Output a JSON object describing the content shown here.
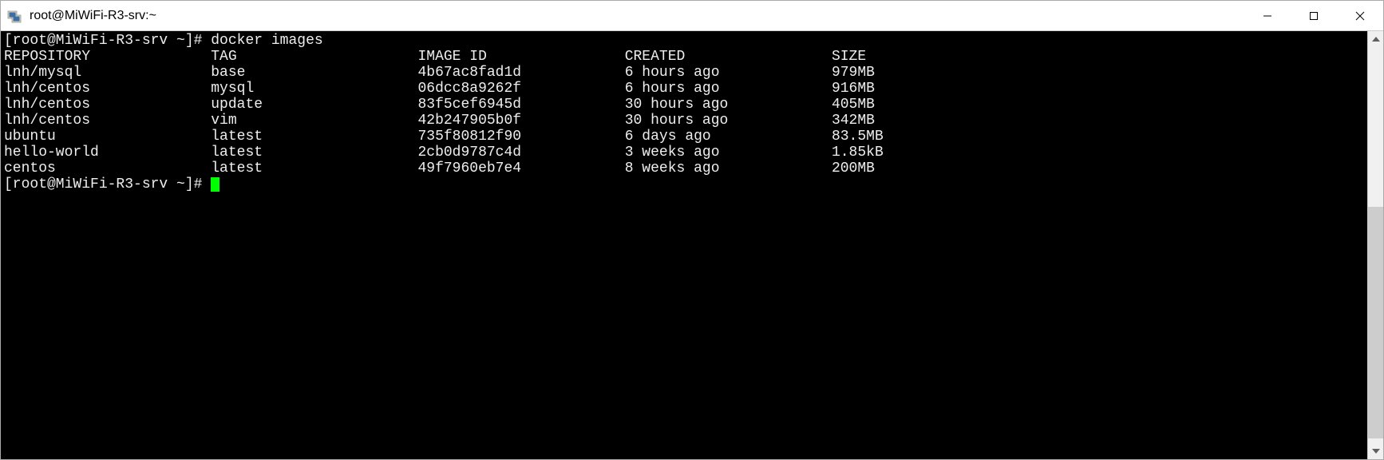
{
  "window": {
    "title": "root@MiWiFi-R3-srv:~"
  },
  "terminal": {
    "prompt1": "[root@MiWiFi-R3-srv ~]# ",
    "command1": "docker images",
    "prompt2": "[root@MiWiFi-R3-srv ~]# ",
    "headers": {
      "repository": "REPOSITORY",
      "tag": "TAG",
      "image_id": "IMAGE ID",
      "created": "CREATED",
      "size": "SIZE"
    },
    "rows": [
      {
        "repository": "lnh/mysql",
        "tag": "base",
        "image_id": "4b67ac8fad1d",
        "created": "6 hours ago",
        "size": "979MB"
      },
      {
        "repository": "lnh/centos",
        "tag": "mysql",
        "image_id": "06dcc8a9262f",
        "created": "6 hours ago",
        "size": "916MB"
      },
      {
        "repository": "lnh/centos",
        "tag": "update",
        "image_id": "83f5cef6945d",
        "created": "30 hours ago",
        "size": "405MB"
      },
      {
        "repository": "lnh/centos",
        "tag": "vim",
        "image_id": "42b247905b0f",
        "created": "30 hours ago",
        "size": "342MB"
      },
      {
        "repository": "ubuntu",
        "tag": "latest",
        "image_id": "735f80812f90",
        "created": "6 days ago",
        "size": "83.5MB"
      },
      {
        "repository": "hello-world",
        "tag": "latest",
        "image_id": "2cb0d9787c4d",
        "created": "3 weeks ago",
        "size": "1.85kB"
      },
      {
        "repository": "centos",
        "tag": "latest",
        "image_id": "49f7960eb7e4",
        "created": "8 weeks ago",
        "size": "200MB"
      }
    ]
  }
}
